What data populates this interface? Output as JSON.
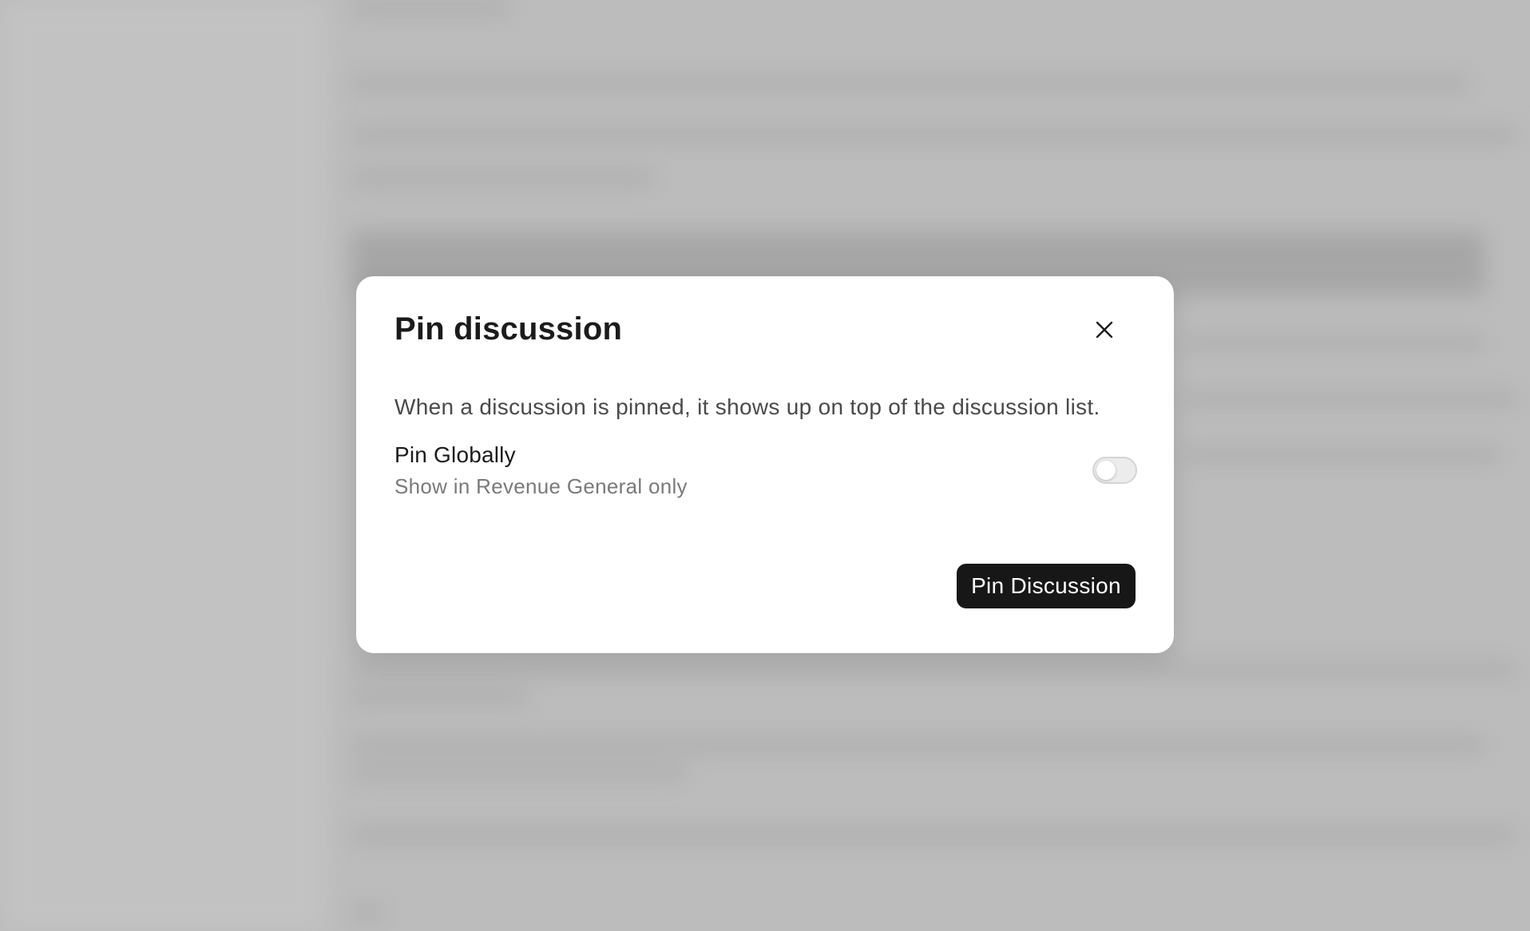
{
  "dialog": {
    "title": "Pin discussion",
    "close_icon": "close-icon",
    "description": "When a discussion is pinned, it shows up on top of the discussion list.",
    "option": {
      "label": "Pin Globally",
      "sublabel": "Show in Revenue General only",
      "toggle_on": false
    },
    "primary_button_label": "Pin Discussion"
  },
  "colors": {
    "overlay": "#bcbcbc",
    "dialog_bg": "#ffffff",
    "primary_button_bg": "#171717",
    "primary_button_text": "#ffffff",
    "title_text": "#1b1b1b",
    "description_text": "#4a4a4a",
    "sublabel_text": "#7a7a7a"
  }
}
